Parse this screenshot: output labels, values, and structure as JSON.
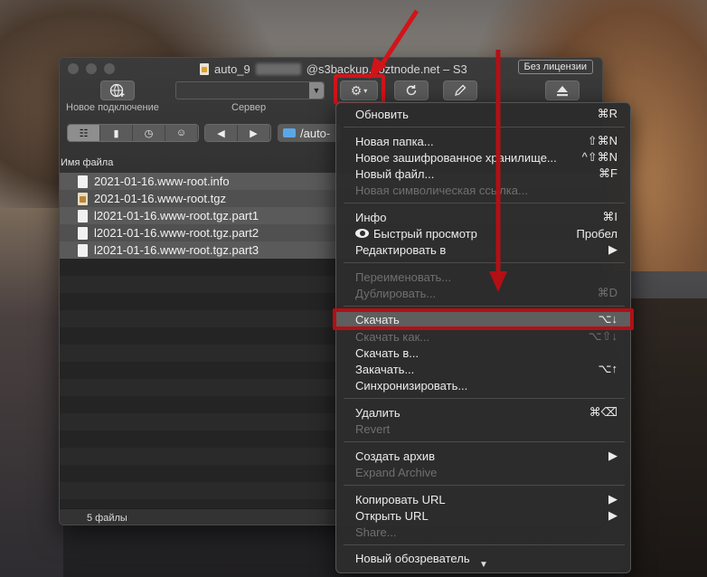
{
  "window": {
    "title_prefix": "auto_9",
    "title_suffix": "@s3backup.hoztnode.net – S3",
    "license_label": "Без лицензии"
  },
  "toolbar": {
    "new_connection_label": "Новое подключение",
    "server_label": "Сервер",
    "path_text": "/auto-"
  },
  "browser": {
    "column_name": "Имя файла",
    "files": [
      {
        "name": "2021-01-16.www-root.info",
        "icon": "document-icon"
      },
      {
        "name": "2021-01-16.www-root.tgz",
        "icon": "archive-icon"
      },
      {
        "name": "l2021-01-16.www-root.tgz.part1",
        "icon": "document-icon"
      },
      {
        "name": "l2021-01-16.www-root.tgz.part2",
        "icon": "document-icon"
      },
      {
        "name": "l2021-01-16.www-root.tgz.part3",
        "icon": "document-icon"
      }
    ],
    "status": "5 файлы"
  },
  "menu": {
    "items": [
      {
        "label": "Обновить",
        "shortcut": "⌘R",
        "disabled": false
      },
      {
        "label": "Новая папка...",
        "shortcut": "⇧⌘N",
        "disabled": false
      },
      {
        "label": "Новое зашифрованное хранилище...",
        "shortcut": "^⇧⌘N",
        "disabled": false
      },
      {
        "label": "Новый файл...",
        "shortcut": "⌘F",
        "disabled": false
      },
      {
        "label": "Новая символическая ссылка...",
        "shortcut": "",
        "disabled": true
      },
      {
        "label": "Инфо",
        "shortcut": "⌘I",
        "disabled": false
      },
      {
        "label": "Быстрый просмотр",
        "shortcut": "Пробел",
        "disabled": false
      },
      {
        "label": "Редактировать в",
        "shortcut": "▶",
        "disabled": false
      },
      {
        "label": "Переименовать...",
        "shortcut": "",
        "disabled": true
      },
      {
        "label": "Дублировать...",
        "shortcut": "⌘D",
        "disabled": true
      },
      {
        "label": "Скачать",
        "shortcut": "⌥↓",
        "disabled": false
      },
      {
        "label": "Скачать как...",
        "shortcut": "⌥⇧↓",
        "disabled": true
      },
      {
        "label": "Скачать в...",
        "shortcut": "",
        "disabled": false
      },
      {
        "label": "Закачать...",
        "shortcut": "⌥↑",
        "disabled": false
      },
      {
        "label": "Синхронизировать...",
        "shortcut": "",
        "disabled": false
      },
      {
        "label": "Удалить",
        "shortcut": "⌘⌫",
        "disabled": false
      },
      {
        "label": "Revert",
        "shortcut": "",
        "disabled": true
      },
      {
        "label": "Создать архив",
        "shortcut": "▶",
        "disabled": false
      },
      {
        "label": "Expand Archive",
        "shortcut": "",
        "disabled": true
      },
      {
        "label": "Копировать URL",
        "shortcut": "▶",
        "disabled": false
      },
      {
        "label": "Открыть URL",
        "shortcut": "▶",
        "disabled": false
      },
      {
        "label": "Share...",
        "shortcut": "",
        "disabled": true
      },
      {
        "label": "Новый обозреватель",
        "shortcut": "",
        "disabled": false
      }
    ]
  },
  "colors": {
    "annotation_red": "#d1141a"
  }
}
